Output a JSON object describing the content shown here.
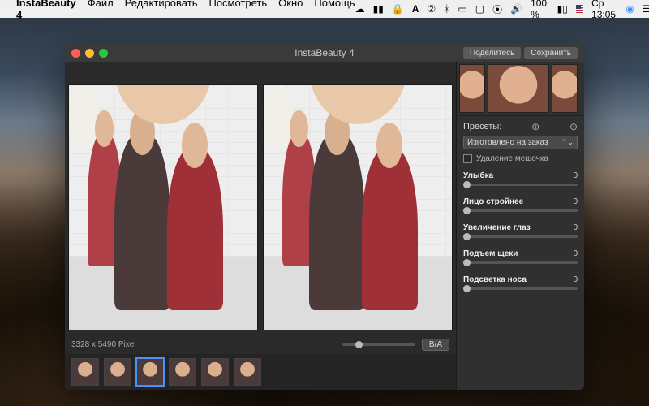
{
  "menubar": {
    "app_name": "InstaBeauty 4",
    "items": [
      "Файл",
      "Редактировать",
      "Посмотреть",
      "Окно",
      "Помощь"
    ],
    "clock": "Ср 13:05",
    "battery": "100 %"
  },
  "window": {
    "title": "InstaBeauty 4",
    "share_btn": "Поделитесь",
    "save_btn": "Сохранить"
  },
  "canvas": {
    "dimensions": "3328 x 5490 Pixel",
    "ba_btn": "B/A"
  },
  "sidebar": {
    "presets_label": "Пресеты:",
    "preset_selected": "Изготовлено на заказ",
    "remove_bags": "Удаление мешочка",
    "sliders": [
      {
        "label": "Улыбка",
        "value": 0
      },
      {
        "label": "Лицо стройнее",
        "value": 0
      },
      {
        "label": "Увеличение глаз",
        "value": 0
      },
      {
        "label": "Подъем щеки",
        "value": 0
      },
      {
        "label": "Подсветка носа",
        "value": 0
      }
    ]
  },
  "thumbs": {
    "count": 6,
    "selected_index": 2
  }
}
